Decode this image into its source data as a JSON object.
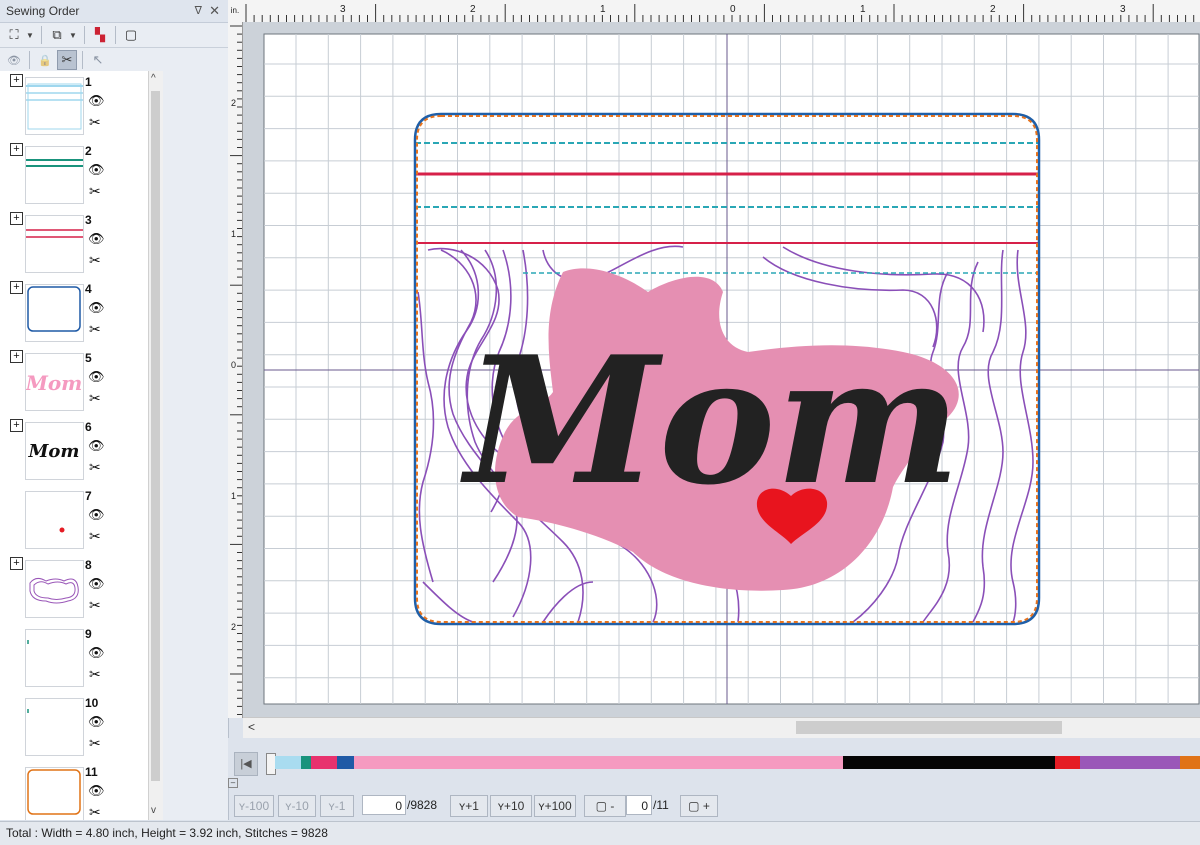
{
  "panel": {
    "title": "Sewing Order",
    "pin_glyph": "ᐁ",
    "close_glyph": "✕"
  },
  "toolbar1": [
    {
      "name": "zoom-fit-icon",
      "glyph": "⛶"
    },
    {
      "name": "group-icon",
      "glyph": "⧉"
    },
    {
      "name": "color-sort-icon",
      "glyph": "▚"
    },
    {
      "name": "frame-icon",
      "glyph": "▢"
    }
  ],
  "toolbar2": [
    {
      "name": "eye-icon",
      "glyph": "👁"
    },
    {
      "name": "lock-icon",
      "glyph": "🔒"
    },
    {
      "name": "scissors-active-icon",
      "glyph": "✂"
    },
    {
      "name": "pointer-icon",
      "glyph": "↖"
    }
  ],
  "items": [
    {
      "num": "1",
      "has_plus": true,
      "thumb": "lines-blue"
    },
    {
      "num": "2",
      "has_plus": true,
      "thumb": "lines-green"
    },
    {
      "num": "3",
      "has_plus": true,
      "thumb": "lines-red"
    },
    {
      "num": "4",
      "has_plus": true,
      "thumb": "rect-blue"
    },
    {
      "num": "5",
      "has_plus": true,
      "thumb": "mom-pink"
    },
    {
      "num": "6",
      "has_plus": true,
      "thumb": "mom-black"
    },
    {
      "num": "7",
      "has_plus": false,
      "thumb": "heart-dot"
    },
    {
      "num": "8",
      "has_plus": true,
      "thumb": "fill-purple"
    },
    {
      "num": "9",
      "has_plus": false,
      "thumb": "tick-green"
    },
    {
      "num": "10",
      "has_plus": false,
      "thumb": "tick-green"
    },
    {
      "num": "11",
      "has_plus": false,
      "thumb": "rect-orange"
    }
  ],
  "ruler": {
    "corner": "in.",
    "top_labels": [
      "3",
      "2",
      "1",
      "0",
      "1",
      "2",
      "3"
    ],
    "left_labels": [
      "2",
      "1",
      "0",
      "1",
      "2"
    ]
  },
  "design": {
    "text": "Mom",
    "colors": {
      "border_blue": "#1f5fa8",
      "border_orange": "#e6731e",
      "line_teal": "#2aa7b5",
      "line_red": "#d62049",
      "fill_purple": "#8a4fb8",
      "pink": "#e58fb2",
      "black": "#222222",
      "heart": "#e8141e"
    }
  },
  "colorbar": [
    {
      "color": "#a9dcf0",
      "w": 26
    },
    {
      "color": "#19937c",
      "w": 10
    },
    {
      "color": "#e8326e",
      "w": 26
    },
    {
      "color": "#1f5aa6",
      "w": 17
    },
    {
      "color": "#f59ac0",
      "w": 489
    },
    {
      "color": "#050505",
      "w": 212
    },
    {
      "color": "#e51c24",
      "w": 25
    },
    {
      "color": "#9a57b8",
      "w": 100
    },
    {
      "color": "#e07317",
      "w": 20
    }
  ],
  "nav": {
    "minus100": "-100",
    "minus10": "-10",
    "minus1": "-1",
    "stitch_value": "0",
    "stitch_total": "/9828",
    "plus1": "+1",
    "plus10": "+10",
    "plus100": "+100",
    "color_minus": "-",
    "color_value": "0",
    "color_total": "/11",
    "color_plus": "+"
  },
  "status": "Total : Width = 4.80 inch, Height = 3.92 inch, Stitches = 9828"
}
